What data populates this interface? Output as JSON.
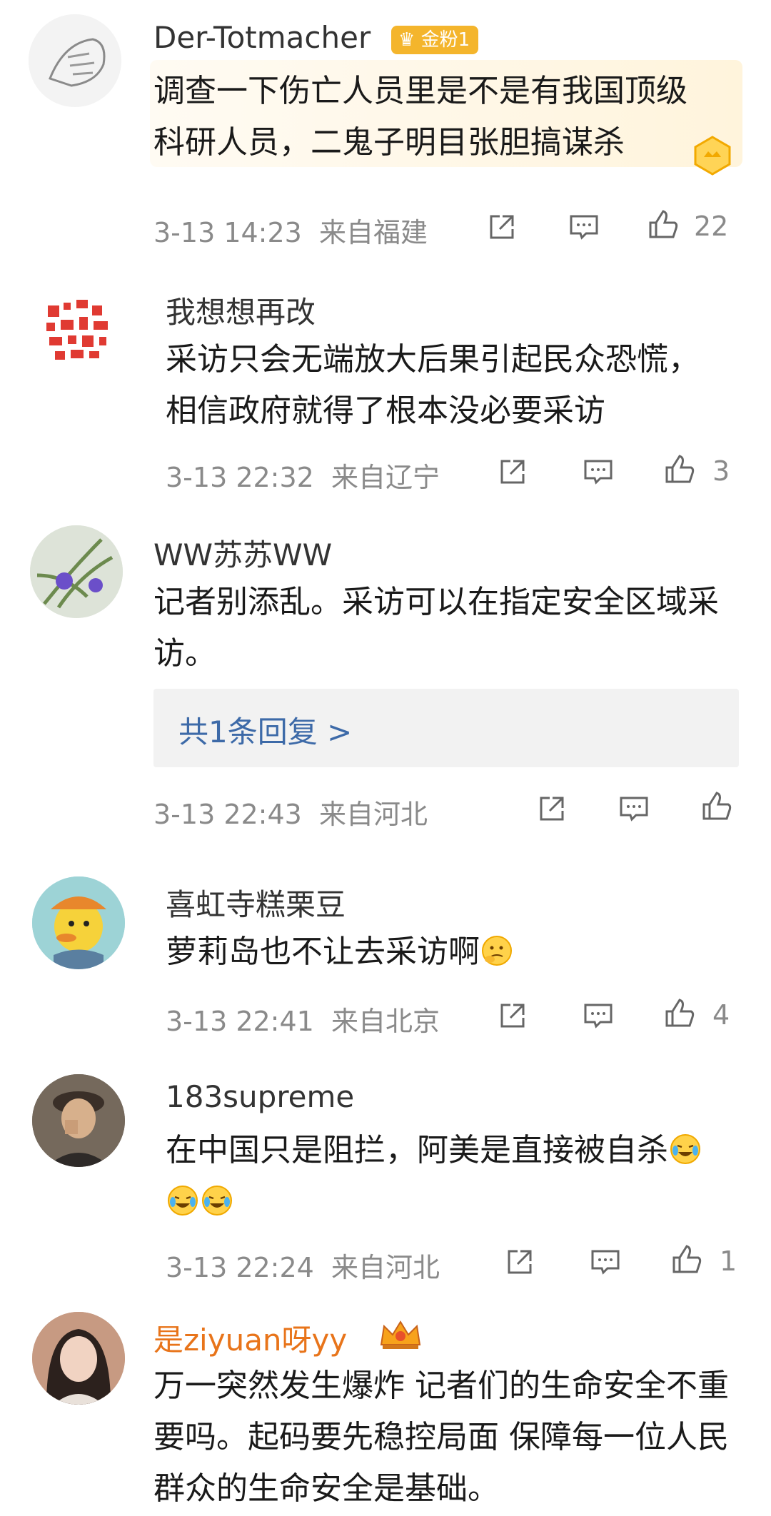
{
  "comments": [
    {
      "username": "Der-Totmacher",
      "badge": "金粉1",
      "text_lines": [
        "调查一下伤亡人员里是不是有我国顶级",
        "科研人员，二鬼子明目张胆搞谋杀"
      ],
      "timestamp": "3-13 14:23",
      "location": "来自福建",
      "likes": "22"
    },
    {
      "username": "我想想再改",
      "text_lines": [
        "采访只会无端放大后果引起民众恐慌，",
        "相信政府就得了根本没必要采访"
      ],
      "timestamp": "3-13 22:32",
      "location": "来自辽宁",
      "likes": "3"
    },
    {
      "username": "WW苏苏WW",
      "text_lines": [
        "记者别添乱。采访可以在指定安全区域采",
        "访。"
      ],
      "reply_link": "共1条回复 >",
      "timestamp": "3-13 22:43",
      "location": "来自河北",
      "likes": ""
    },
    {
      "username": "喜虹寺糕栗豆",
      "text_lines": [
        "萝莉岛也不让去采访啊"
      ],
      "timestamp": "3-13 22:41",
      "location": "来自北京",
      "likes": "4"
    },
    {
      "username": "183supreme",
      "text_lines": [
        "在中国只是阻拦，阿美是直接被自杀"
      ],
      "timestamp": "3-13 22:24",
      "location": "来自河北",
      "likes": "1"
    },
    {
      "username": "是ziyuan呀yy",
      "text_lines": [
        "万一突然发生爆炸 记者们的生命安全不重",
        "要吗。起码要先稳控局面 保障每一位人民",
        "群众的生命安全是基础。"
      ]
    }
  ],
  "colors": {
    "gold_username": "#e8741a",
    "reply_link": "#3d6aa8",
    "meta_gray": "#8a8a8a",
    "badge": "#f4b52c"
  },
  "icons": [
    "share-icon",
    "comment-icon",
    "like-icon",
    "laugh-cry-emoji",
    "thinking-emoji",
    "crown-icon"
  ]
}
